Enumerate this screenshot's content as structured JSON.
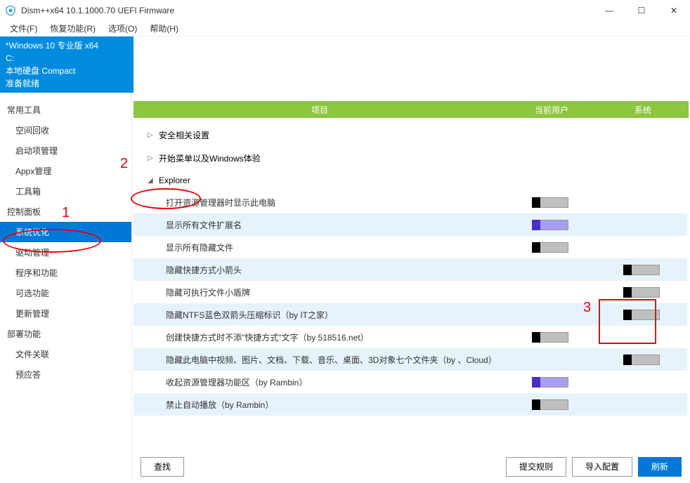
{
  "window": {
    "title": "Dism++x64 10.1.1000.70 UEFI Firmware"
  },
  "menu": {
    "file": "文件(F)",
    "recovery": "恢复功能(R)",
    "options": "选项(O)",
    "help": "帮助(H)"
  },
  "info": {
    "line1": "*Windows 10 专业版 x64",
    "line2": "C:",
    "line3": "本地硬盘 Compact",
    "line4": "准备就绪"
  },
  "sidebar": {
    "cat1": "常用工具",
    "items1": [
      "空间回收",
      "启动项管理",
      "Appx管理",
      "工具箱"
    ],
    "cat2": "控制面板",
    "items2": [
      "系统优化",
      "驱动管理",
      "程序和功能",
      "可选功能",
      "更新管理"
    ],
    "cat3": "部署功能",
    "items3": [
      "文件关联",
      "预应答"
    ]
  },
  "headers": {
    "col1": "项目",
    "col2": "当前用户",
    "col3": "系统"
  },
  "groups": {
    "g1": "安全相关设置",
    "g2": "开始菜单以及Windows体验",
    "g3": "Explorer"
  },
  "rows": [
    {
      "label": "打开资源管理器时显示此电脑",
      "user": true,
      "sys": false,
      "userOn": false
    },
    {
      "label": "显示所有文件扩展名",
      "user": true,
      "sys": false,
      "userOn": true
    },
    {
      "label": "显示所有隐藏文件",
      "user": true,
      "sys": false,
      "userOn": false
    },
    {
      "label": "隐藏快捷方式小箭头",
      "user": false,
      "sys": true,
      "sysOn": false
    },
    {
      "label": "隐藏可执行文件小盾牌",
      "user": false,
      "sys": true,
      "sysOn": false
    },
    {
      "label": "隐藏NTFS蓝色双箭头压缩标识（by IT之家）",
      "user": false,
      "sys": true,
      "sysOn": false
    },
    {
      "label": "创建快捷方式时不添\"快捷方式\"文字（by 518516.net）",
      "user": true,
      "sys": false,
      "userOn": false
    },
    {
      "label": "隐藏此电脑中视频、图片、文档、下载、音乐、桌面、3D对象七个文件夹（by 、Cloud）",
      "user": false,
      "sys": true,
      "sysOn": false
    },
    {
      "label": "收起资源管理器功能区（by Rambin）",
      "user": true,
      "sys": false,
      "userOn": true
    },
    {
      "label": "禁止自动播放（by Rambin）",
      "user": true,
      "sys": false,
      "userOn": false
    }
  ],
  "buttons": {
    "find": "查找",
    "submit": "提交规则",
    "import": "导入配置",
    "refresh": "刷新"
  },
  "annotations": {
    "a1": "1",
    "a2": "2",
    "a3": "3"
  }
}
